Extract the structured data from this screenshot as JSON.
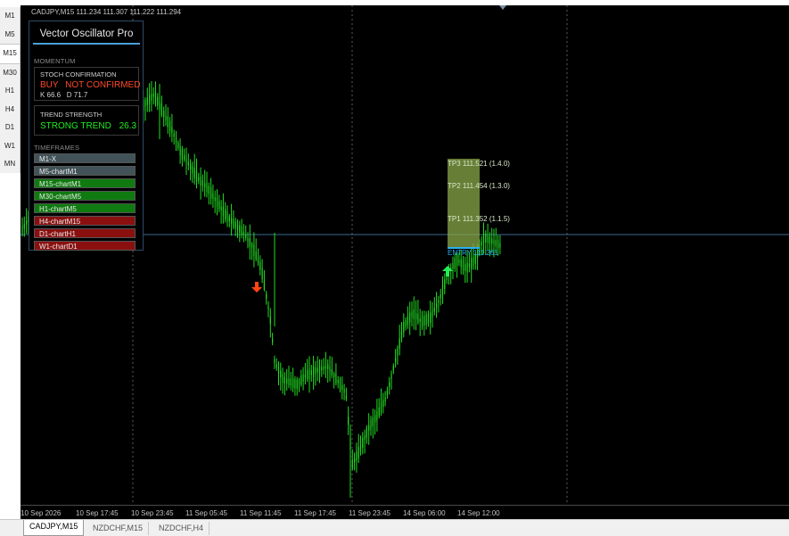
{
  "timeframes": [
    "M1",
    "M5",
    "M15",
    "M30",
    "H1",
    "H4",
    "D1",
    "W1",
    "MN"
  ],
  "active_timeframe": "M15",
  "chart": {
    "header": "CADJPY,M15  111.234 111.307 111.222 111.294",
    "time_labels": [
      "10 Sep 2026",
      "10 Sep 17:45",
      "10 Sep 23:45",
      "11 Sep 05:45",
      "11 Sep 11:45",
      "11 Sep 17:45",
      "11 Sep 23:45",
      "14 Sep 06:00",
      "14 Sep 12:00"
    ],
    "targets": {
      "tp3": "TP3 111.521 (1.4.0)",
      "tp2": "TP2 111.454 (1.3.0)",
      "tp1": "TP1 111.352 (1.1.5)",
      "entry": "ENTRY 111.261"
    },
    "colors": {
      "bull": "#22dd22",
      "sell_arrow": "#ff4411",
      "buy_arrow": "#22ee55",
      "target_zone": "#8aa84a",
      "entry_line": "#2ab0ee"
    }
  },
  "panel": {
    "title": "Vector Oscillator Pro",
    "momentum_label": "MOMENTUM",
    "stoch": {
      "title": "STOCH CONFIRMATION",
      "signal": "BUY",
      "status": "NOT CONFIRMED",
      "values": "K 66.6   D 71.7"
    },
    "trend": {
      "title": "TREND STRENGTH",
      "status": "STRONG TREND",
      "value": "26.3"
    },
    "timeframes_label": "TIMEFRAMES",
    "rows": [
      {
        "label": "M1-X",
        "state": "grey"
      },
      {
        "label": "M5-chartM1",
        "state": "grey"
      },
      {
        "label": "M15-chartM1",
        "state": "green"
      },
      {
        "label": "M30-chartM5",
        "state": "green"
      },
      {
        "label": "H1-chartM5",
        "state": "green"
      },
      {
        "label": "H4-chartM15",
        "state": "red"
      },
      {
        "label": "D1-chartH1",
        "state": "red"
      },
      {
        "label": "W1-chartD1",
        "state": "red"
      }
    ]
  },
  "tabs": [
    "CADJPY,M15",
    "NZDCHF,M15",
    "NZDCHF,H4"
  ],
  "active_tab": "CADJPY,M15"
}
